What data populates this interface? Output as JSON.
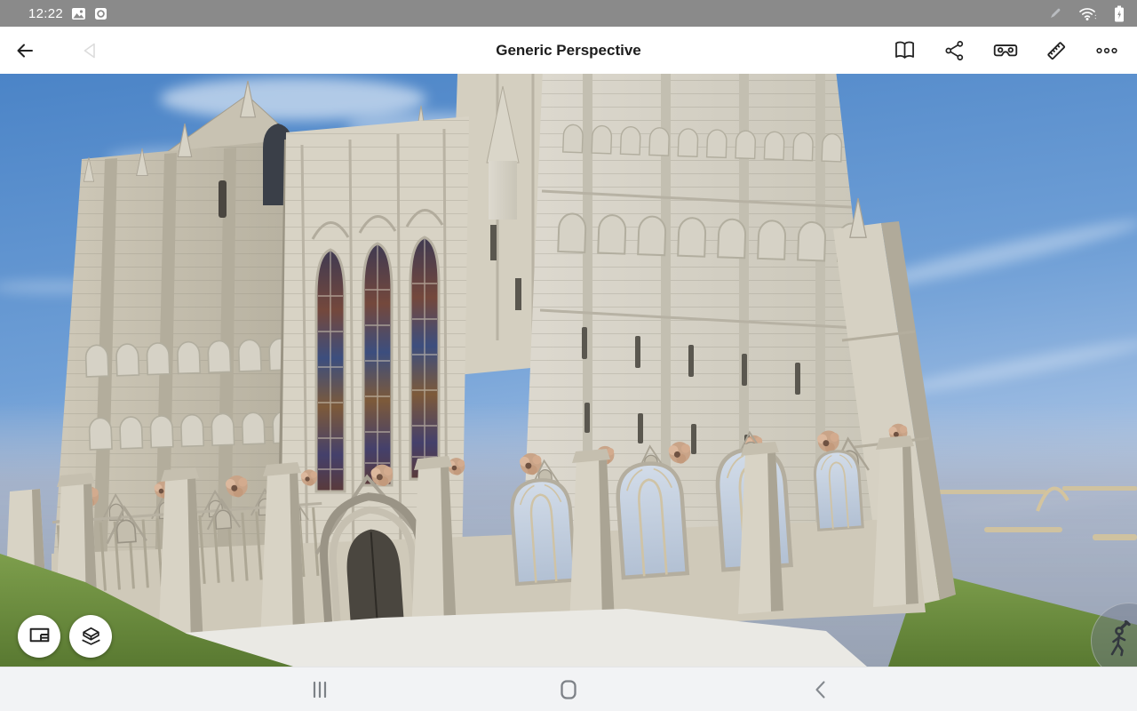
{
  "status_bar": {
    "time": "12:22",
    "left_icons": [
      "image-notification-icon",
      "screen-record-notification-icon"
    ],
    "right_icons": [
      "stylus-icon",
      "wifi-icon",
      "battery-charging-icon"
    ]
  },
  "toolbar": {
    "title": "Generic Perspective",
    "back_icon": "back-arrow-icon",
    "previous_view_icon": "previous-view-icon",
    "action_icons": [
      "gallery-book-icon",
      "share-icon",
      "vr-goggles-icon",
      "measure-ruler-icon",
      "more-options-icon"
    ]
  },
  "viewport": {
    "scene_description": "3D model view of a Gothic cathedral west facade with towers, stained glass lancet windows, pointed portal, rosette carvings, green lawn and hazy blue horizon",
    "colors": {
      "sky_top": "#4b84c7",
      "sky_horizon": "#c8d5e6",
      "haze": "#97a1b2",
      "stone_light": "#ddd9cf",
      "stone_shadow": "#a8a294",
      "grass": "#6b8f3f",
      "stained_glass": "#3c4e7e",
      "pale_glass": "#c3d0e0",
      "rosette": "#c9a488",
      "pavement": "#eae9e4"
    },
    "buttons": {
      "sheets": "sheets-layouts-button",
      "model": "model-3d-button",
      "walk": "walk-mode-button"
    }
  },
  "nav_bar": {
    "icons": [
      "recent-apps-icon",
      "home-icon",
      "back-icon"
    ]
  }
}
